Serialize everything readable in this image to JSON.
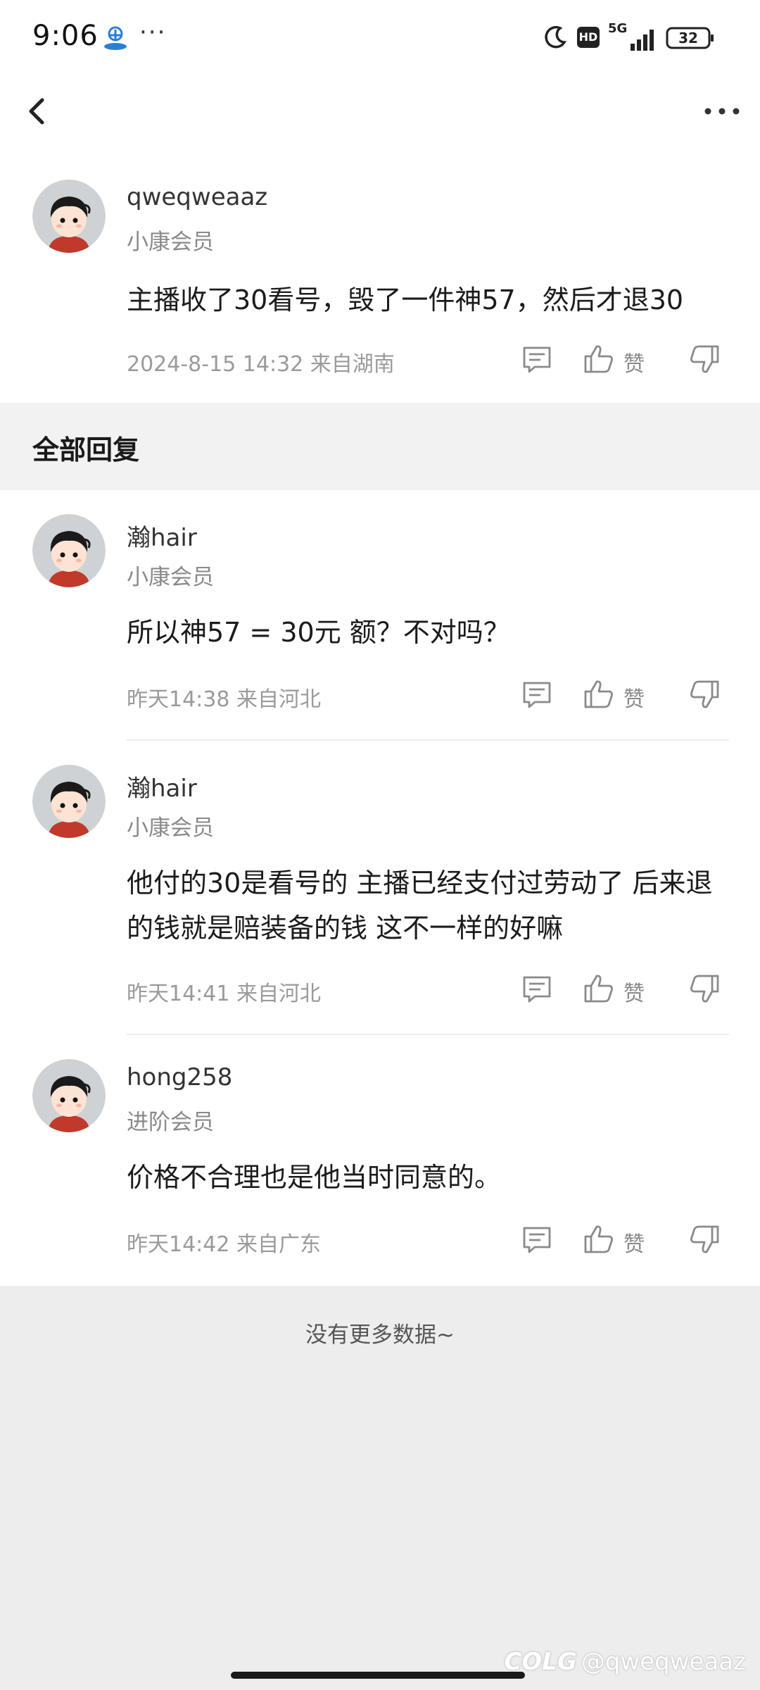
{
  "status_bar": {
    "time": "9:06",
    "dots": "···",
    "hd": "HD",
    "network": "5G",
    "battery": "32"
  },
  "main_comment": {
    "username": "qweqweaaz",
    "level": "小康会员",
    "content": "主播收了30看号，毁了一件神57，然后才退30",
    "meta": "2024-8-15 14:32  来自湖南",
    "like_label": "赞"
  },
  "section": {
    "title": "全部回复"
  },
  "replies": [
    {
      "username": "瀚hair",
      "level": "小康会员",
      "content": "所以神57 = 30元  额？不对吗？",
      "meta": "昨天14:38 来自河北",
      "like_label": "赞"
    },
    {
      "username": "瀚hair",
      "level": "小康会员",
      "content": "他付的30是看号的  主播已经支付过劳动了   后来退的钱就是赔装备的钱  这不一样的好嘛",
      "meta": "昨天14:41 来自河北",
      "like_label": "赞"
    },
    {
      "username": "hong258",
      "level": "进阶会员",
      "content": "价格不合理也是他当时同意的。",
      "meta": "昨天14:42 来自广东",
      "like_label": "赞"
    }
  ],
  "footer": {
    "no_more": "没有更多数据~",
    "watermark": "@qweqweaaz",
    "watermark_logo": "COLG"
  },
  "colors": {
    "divider": "#ededed",
    "section_bg": "#f2f2f2",
    "footer_bg": "#ededed",
    "muted_text": "#9a9a9a"
  },
  "icons": [
    "carrier-icon",
    "moon-icon",
    "signal-icon",
    "battery-icon",
    "back-icon",
    "more-icon",
    "comment-icon",
    "thumb-up-icon",
    "thumb-down-icon",
    "avatar"
  ]
}
